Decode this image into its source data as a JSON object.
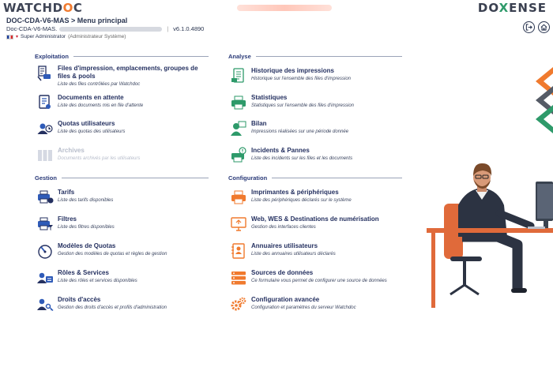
{
  "brand": {
    "left_logo": "WATCHDOC",
    "right_logo": "DOXENSE"
  },
  "header": {
    "title": "DOC-CDA-V6-MAS > Menu principal",
    "server": "Doc-CDA-V6-MAS.",
    "version": "v6.1.0.4890",
    "user": "Super Administrator",
    "role": "(Administrateur Système)"
  },
  "toolbar": {
    "logout_icon": "logout-icon",
    "home_icon": "home-icon"
  },
  "sections": {
    "exploitation": {
      "title": "Exploitation",
      "items": [
        {
          "title": "Files d'impression, emplacements, groupes de files & pools",
          "desc": "Liste des files contrôlées par Watchdoc"
        },
        {
          "title": "Documents en attente",
          "desc": "Liste des documents mis en file d'attente"
        },
        {
          "title": "Quotas utilisateurs",
          "desc": "Liste des quotas des utilisateurs"
        },
        {
          "title": "Archives",
          "desc": "Documents archivés par les utilisateurs"
        }
      ]
    },
    "analyse": {
      "title": "Analyse",
      "items": [
        {
          "title": "Historique des impressions",
          "desc": "Historique sur l'ensemble des files d'impression"
        },
        {
          "title": "Statistiques",
          "desc": "Statistiques sur l'ensemble des files d'impression"
        },
        {
          "title": "Bilan",
          "desc": "Impressions réalisées sur une période donnée"
        },
        {
          "title": "Incidents & Pannes",
          "desc": "Liste des incidents sur les files et les documents"
        }
      ]
    },
    "gestion": {
      "title": "Gestion",
      "items": [
        {
          "title": "Tarifs",
          "desc": "Liste des tarifs disponibles"
        },
        {
          "title": "Filtres",
          "desc": "Liste des filtres disponibles"
        },
        {
          "title": "Modèles de Quotas",
          "desc": "Gestion des modèles de quotas et règles de gestion"
        },
        {
          "title": "Rôles & Services",
          "desc": "Liste des rôles et services disponibles"
        },
        {
          "title": "Droits d'accès",
          "desc": "Gestion des droits d'accès et profils d'administration"
        }
      ]
    },
    "configuration": {
      "title": "Configuration",
      "items": [
        {
          "title": "Imprimantes & périphériques",
          "desc": "Liste des périphériques déclarés sur le système"
        },
        {
          "title": "Web, WES & Destinations de numérisation",
          "desc": "Gestion des interfaces clientes"
        },
        {
          "title": "Annuaires utilisateurs",
          "desc": "Liste des annuaires utilisateurs déclarés"
        },
        {
          "title": "Sources de données",
          "desc": "Ce formulaire vous permet de configurer une source de données"
        },
        {
          "title": "Configuration avancée",
          "desc": "Configuration et paramètres du serveur Watchdoc"
        }
      ]
    }
  },
  "colors": {
    "navy": "#243060",
    "orange": "#f07a2e",
    "green": "#2e9a6a",
    "blue": "#2f5bb8"
  }
}
